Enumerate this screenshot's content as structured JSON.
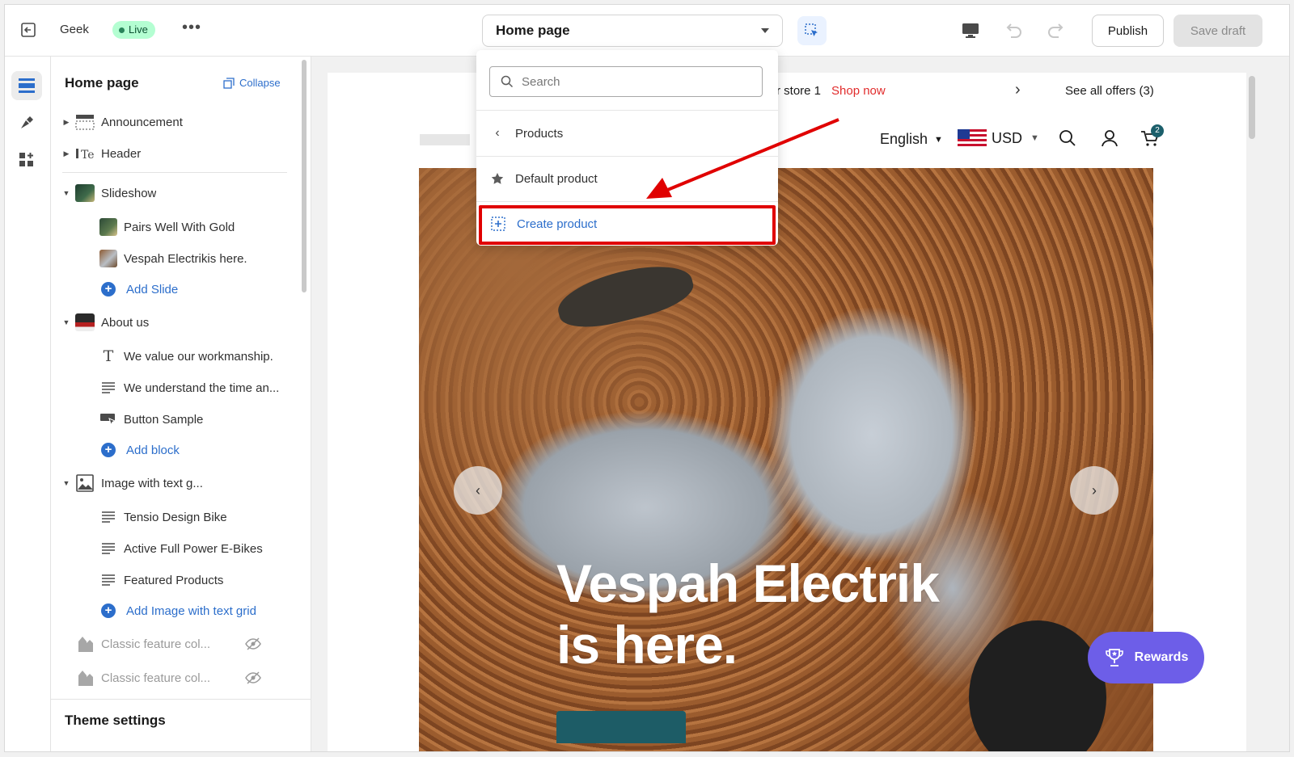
{
  "topbar": {
    "store_name": "Geek",
    "status_badge": "Live",
    "more_label": "•••",
    "page_selector": "Home page",
    "publish_label": "Publish",
    "save_draft_label": "Save draft"
  },
  "rail": {
    "icons": [
      "sections-icon",
      "brush-icon",
      "apps-icon"
    ]
  },
  "sidebar": {
    "title": "Home page",
    "collapse_label": "Collapse",
    "sections": [
      {
        "label": "Announcement",
        "type": "section"
      },
      {
        "label": "Header",
        "type": "section"
      },
      {
        "label": "Slideshow",
        "type": "section",
        "children": [
          "Pairs Well With Gold",
          "Vespah Electrikis here."
        ],
        "add_label": "Add Slide"
      },
      {
        "label": "About us",
        "type": "section",
        "children": [
          "We value our workmanship.",
          "We understand the time an...",
          "Button Sample"
        ],
        "add_label": "Add block"
      },
      {
        "label": "Image with text g...",
        "type": "section",
        "children": [
          "Tensio Design Bike",
          "Active Full Power E-Bikes",
          "Featured Products"
        ],
        "add_label": "Add Image with text grid"
      },
      {
        "label": "Classic feature col...",
        "type": "hidden"
      },
      {
        "label": "Classic feature col...",
        "type": "hidden"
      }
    ],
    "footer_label": "Theme settings"
  },
  "dropdown": {
    "search_placeholder": "Search",
    "back_item": "Products",
    "default_item": "Default product",
    "create_item": "Create product"
  },
  "preview": {
    "announcement_text": "r store 1",
    "announcement_link": "Shop now",
    "offers_label": "See all offers (3)",
    "language": "English",
    "currency": "USD",
    "cart_count": "2",
    "hero_line1": "Vespah Electrik",
    "hero_line2": "is here.",
    "rewards_label": "Rewards"
  },
  "colors": {
    "accent": "#2c6ecb",
    "live_bg": "#b4fed2",
    "highlight_red": "#e00000",
    "rewards_purple": "#6d5ee8",
    "announcement_link": "#e12c2c"
  }
}
